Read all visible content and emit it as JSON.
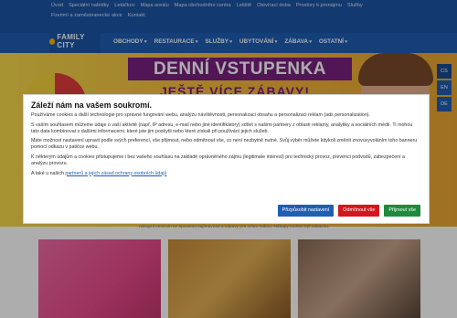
{
  "topbar": {
    "links": [
      "Úvod",
      "Speciální nabídky",
      "Letáčkov",
      "Mapa areálu",
      "Mapa obchodního centra",
      "Letiště",
      "Otevírací doba",
      "Prostory k pronájmu",
      "Služby",
      "Firemní a zaměstnanecké akce",
      "Kontakt"
    ]
  },
  "logo": {
    "text": "FAMILY CITY"
  },
  "nav": {
    "items": [
      "OBCHODY",
      "RESTAURACE",
      "SLUŽBY",
      "UBYTOVÁNÍ",
      "ZÁBAVA",
      "OSTATNÍ"
    ]
  },
  "banner": {
    "title": "DENNÍ VSTUPENKA",
    "subtitle": "JEŠTĚ VÍCE ZÁBAVY!"
  },
  "languages": [
    "CS",
    "EN",
    "DE"
  ],
  "below": {
    "text": "nákupní centrum se spoustou zajímavostí a zábavy pro celou rodinu. Nákupy mohou být zábavou."
  },
  "consent": {
    "title": "Záleží nám na vašem soukromí.",
    "p1": "Používáme cookies a další technologie pro správné fungování webu, analýzu návštěvnosti, personalizaci obsahu a personalizaci reklam (ads personalization).",
    "p2": "S vaším souhlasem můžeme údaje o vaší aktivitě (např. IP adresu, e-mail nebo jiné identifikátory) sdílet s našimi partnery z oblasti reklamy, analytiky a sociálních médií. Ti mohou tato data kombinovat s dalšími informacemi, které jste jim poskytli nebo které získali při používání jejich služeb.",
    "p3": "Máte možnost nastavení upravit podle svých preferencí, vše přijmout, nebo odmítnout vše, co není nezbytně nutné. Svůj výběr můžete kdykoli změnit znovuvyvoláním toho banneru pomocí odkazu v patičce webu.",
    "p4": "K některým údajům a cookies přistupujeme i bez vašeho souhlasu na základě oprávněného zájmu (legitimate interest) pro technický provoz, prevenci podvodů, zabezpečení a analýzu provozu.",
    "p5_prefix": "A také u našich ",
    "p5_link": "partnerů a jejich zásad ochrany osobních údajů",
    "buttons": {
      "customize": "Přizpůsobit nastavení",
      "reject": "Odmítnout vše",
      "accept": "Přijmout vše"
    }
  }
}
